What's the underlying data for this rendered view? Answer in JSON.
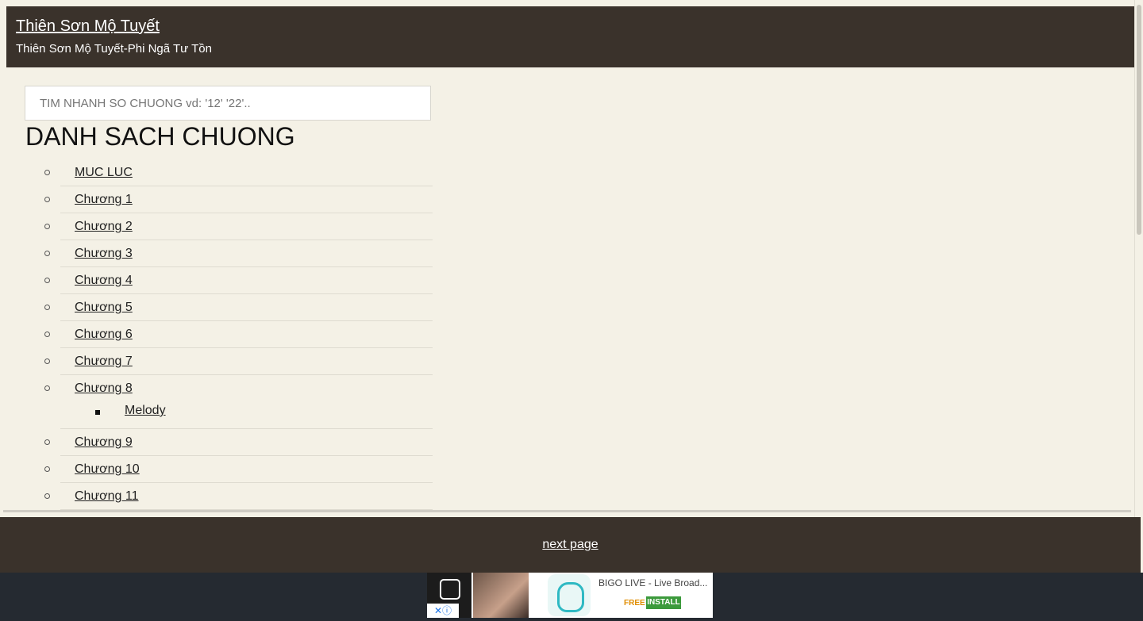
{
  "header": {
    "title": "Thiên Sơn Mộ Tuyết",
    "subtitle": "Thiên Sơn Mộ Tuyết-Phi Ngã Tư Tồn"
  },
  "search": {
    "placeholder": "TIM NHANH SO CHUONG vd: '12' '22'.."
  },
  "section_title": "DANH SACH CHUONG",
  "chapters": [
    {
      "label": "MUC LUC"
    },
    {
      "label": "Chương 1"
    },
    {
      "label": "Chương 2"
    },
    {
      "label": "Chương 3"
    },
    {
      "label": "Chương 4"
    },
    {
      "label": "Chương 5"
    },
    {
      "label": "Chương 6"
    },
    {
      "label": "Chương 7"
    },
    {
      "label": "Chương 8",
      "sub": "Melody"
    },
    {
      "label": "Chương 9"
    },
    {
      "label": "Chương 10"
    },
    {
      "label": "Chương 11"
    }
  ],
  "footer": {
    "next_page": "next page"
  },
  "ad": {
    "title": "BIGO LIVE - Live Broad...",
    "free": "FREE",
    "install": "INSTALL",
    "close": "✕ⓘ"
  }
}
